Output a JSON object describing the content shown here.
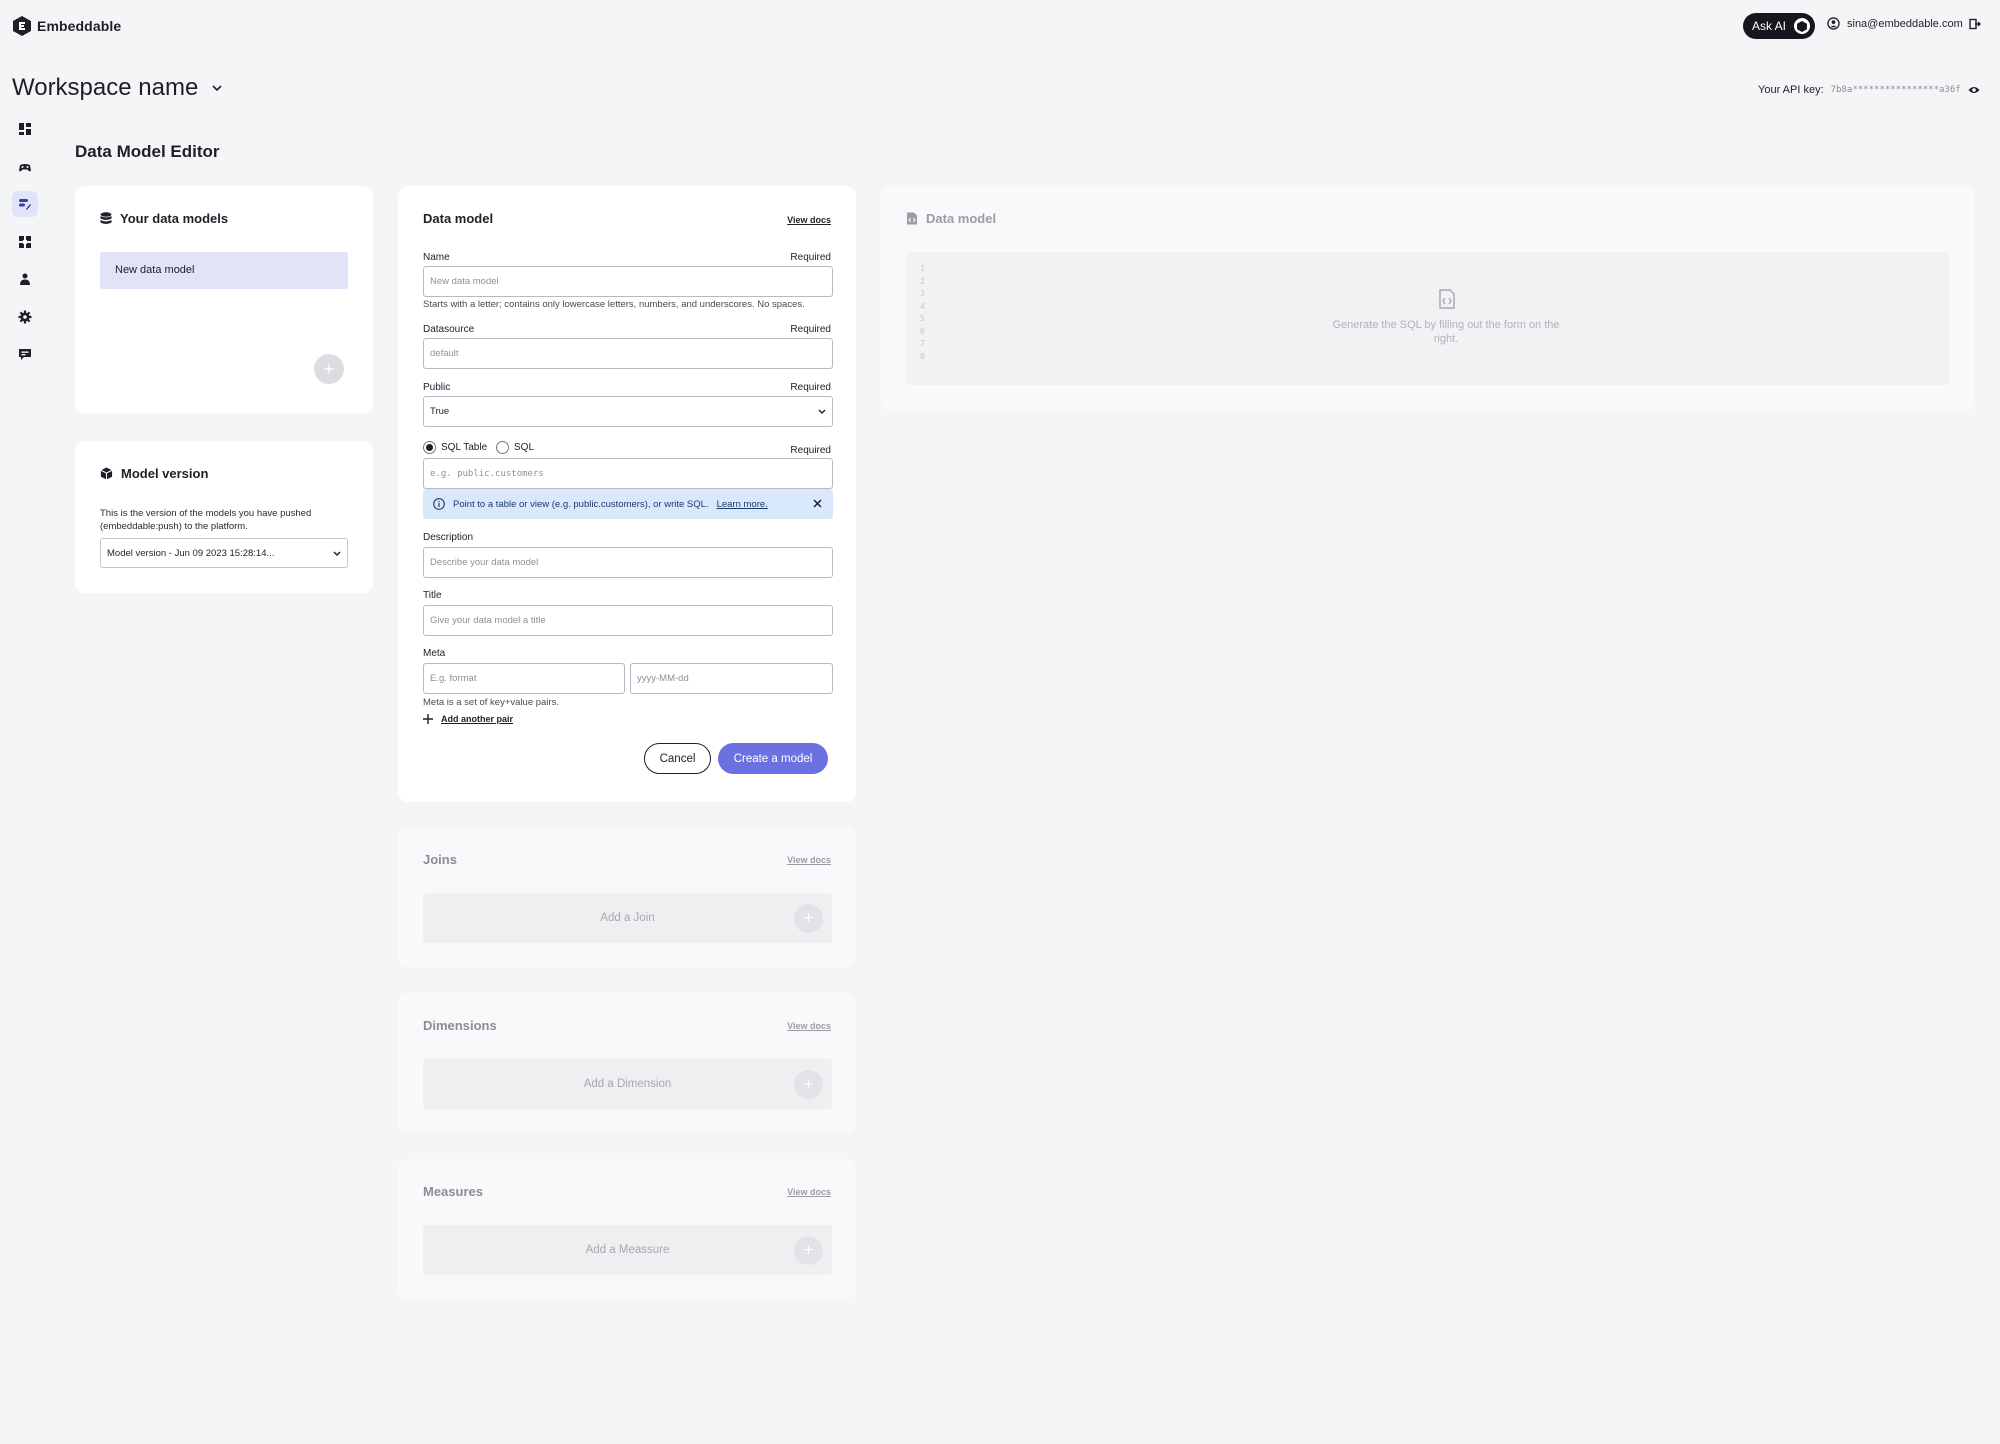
{
  "header": {
    "brand": "Embeddable",
    "ask_ai": "Ask AI",
    "user_email": "sina@embeddable.com",
    "workspace_name": "Workspace name",
    "api_key_label": "Your API key:",
    "api_key_value": "7b8a****************a36f"
  },
  "nav": {
    "items": [
      "dashboards-icon",
      "gamepad-icon",
      "data-model-icon",
      "components-icon",
      "team-icon",
      "settings-icon",
      "feedback-icon"
    ],
    "active_index": 2
  },
  "page": {
    "title": "Data Model Editor"
  },
  "models": {
    "title": "Your data models",
    "items": [
      "New data model"
    ],
    "add": "+"
  },
  "version": {
    "title": "Model version",
    "description": "This is the version of the models you have pushed (embeddable:push) to the platform.",
    "selected": "Model version - Jun 09 2023 15:28:14..."
  },
  "form": {
    "title": "Data model",
    "view_docs": "View docs",
    "required": "Required",
    "name": {
      "label": "Name",
      "placeholder": "New data model",
      "hint": "Starts with a letter; contains only lowercase letters, numbers, and underscores. No spaces."
    },
    "datasource": {
      "label": "Datasource",
      "placeholder": "default"
    },
    "public": {
      "label": "Public",
      "value": "True"
    },
    "source": {
      "option_table": "SQL Table",
      "option_sql": "SQL",
      "selected": "SQL Table",
      "placeholder": "e.g. public.customers"
    },
    "info": {
      "text": "Point to a table or view (e.g. public.customers), or write SQL.",
      "link": "Learn more."
    },
    "description": {
      "label": "Description",
      "placeholder": "Describe your data model"
    },
    "title_field": {
      "label": "Title",
      "placeholder": "Give your data model a title"
    },
    "meta": {
      "label": "Meta",
      "key_placeholder": "E.g. format",
      "value_placeholder": "yyyy-MM-dd",
      "hint": "Meta is a set of key+value pairs.",
      "add_pair": "Add another pair"
    },
    "cancel": "Cancel",
    "create": "Create a model"
  },
  "sections": [
    {
      "title": "Joins",
      "view_docs": "View docs",
      "add": "Add a Join"
    },
    {
      "title": "Dimensions",
      "view_docs": "View docs",
      "add": "Add a Dimension"
    },
    {
      "title": "Measures",
      "view_docs": "View docs",
      "add": "Add a Meassure"
    }
  ],
  "preview": {
    "title": "Data model",
    "line_numbers": [
      "1",
      "2",
      "3",
      "4",
      "5",
      "6",
      "7",
      "8"
    ],
    "empty_text": "Generate the SQL by filling out the form on the right."
  },
  "colors": {
    "primary": "#6c71e2",
    "selection": "#e1e3f8",
    "info_bg": "#d9e8fb",
    "dark": "#16161f"
  }
}
